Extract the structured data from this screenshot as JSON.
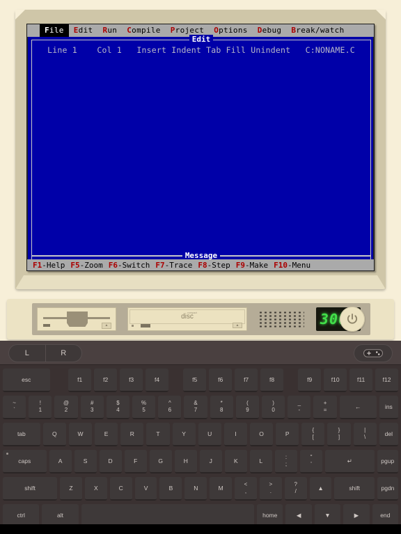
{
  "dos": {
    "menubar": [
      {
        "pre": "",
        "hot": "F",
        "post": "ile",
        "selected": true
      },
      {
        "pre": "",
        "hot": "E",
        "post": "dit",
        "selected": false
      },
      {
        "pre": "",
        "hot": "R",
        "post": "un",
        "selected": false
      },
      {
        "pre": "",
        "hot": "C",
        "post": "ompile",
        "selected": false
      },
      {
        "pre": "",
        "hot": "P",
        "post": "roject",
        "selected": false
      },
      {
        "pre": "",
        "hot": "O",
        "post": "ptions",
        "selected": false
      },
      {
        "pre": "",
        "hot": "D",
        "post": "ebug",
        "selected": false
      },
      {
        "pre": "",
        "hot": "B",
        "post": "reak/watch",
        "selected": false
      }
    ],
    "edit_window": {
      "title": "Edit",
      "status_line": "Line 1    Col 1   Insert Indent Tab Fill Unindent   C:NONAME.C",
      "line": "Line 1",
      "col": "Col 1",
      "insert_mode": "Insert",
      "indent": "Indent",
      "tab": "Tab",
      "fill": "Fill",
      "unindent": "Unindent",
      "filename": "C:NONAME.C",
      "body_text": ""
    },
    "message_window": {
      "title": "Message",
      "body_text": ""
    },
    "fkeys": [
      {
        "hot": "F1",
        "label": "-Help"
      },
      {
        "hot": "F5",
        "label": "-Zoom"
      },
      {
        "hot": "F6",
        "label": "-Switch"
      },
      {
        "hot": "F7",
        "label": "-Trace"
      },
      {
        "hot": "F8",
        "label": "-Step"
      },
      {
        "hot": "F9",
        "label": "-Make"
      },
      {
        "hot": "F10",
        "label": "-Menu"
      }
    ],
    "colors": {
      "screen_blue": "#0000a8",
      "menubar_gray": "#aaaaaa",
      "hotkey_red": "#aa0000",
      "status_text": "#b8b8c8"
    }
  },
  "pc_case": {
    "floppy_drive": {
      "name": "floppy-drive",
      "eject_label": "▲"
    },
    "cd_drive": {
      "logo_main": "disc",
      "logo_small": "compact",
      "eject_label": "▲"
    },
    "speaker": {
      "name": "speaker-grille"
    },
    "led_display": {
      "value": "3000",
      "color": "#42e04a"
    },
    "power_button": {
      "label": "power"
    }
  },
  "keyboard": {
    "toolbar": {
      "mouse_left": "L",
      "mouse_right": "R",
      "gamepad": "gamepad-icon"
    },
    "rows": [
      {
        "name": "function-row",
        "keys": [
          {
            "label": "esc",
            "flex": 2.05
          },
          {
            "spacer": true,
            "flex": 0.85
          },
          {
            "label": "f1",
            "flex": 1
          },
          {
            "label": "f2",
            "flex": 1
          },
          {
            "label": "f3",
            "flex": 1
          },
          {
            "label": "f4",
            "flex": 1
          },
          {
            "spacer": true,
            "flex": 0.6
          },
          {
            "label": "f5",
            "flex": 1
          },
          {
            "label": "f6",
            "flex": 1
          },
          {
            "label": "f7",
            "flex": 1
          },
          {
            "label": "f8",
            "flex": 1
          },
          {
            "spacer": true,
            "flex": 0.6
          },
          {
            "label": "f9",
            "flex": 1
          },
          {
            "label": "f10",
            "flex": 1
          },
          {
            "label": "f11",
            "flex": 1
          },
          {
            "label": "f12",
            "flex": 1
          }
        ]
      },
      {
        "name": "number-row",
        "keys": [
          {
            "top": "~",
            "bot": "`",
            "flex": 1
          },
          {
            "top": "!",
            "bot": "1",
            "flex": 1
          },
          {
            "top": "@",
            "bot": "2",
            "flex": 1
          },
          {
            "top": "#",
            "bot": "3",
            "flex": 1
          },
          {
            "top": "$",
            "bot": "4",
            "flex": 1
          },
          {
            "top": "%",
            "bot": "5",
            "flex": 1
          },
          {
            "top": "^",
            "bot": "6",
            "flex": 1
          },
          {
            "top": "&",
            "bot": "7",
            "flex": 1
          },
          {
            "top": "*",
            "bot": "8",
            "flex": 1
          },
          {
            "top": "(",
            "bot": "9",
            "flex": 1
          },
          {
            "top": ")",
            "bot": "0",
            "flex": 1
          },
          {
            "top": "_",
            "bot": "-",
            "flex": 1
          },
          {
            "top": "+",
            "bot": "=",
            "flex": 1
          },
          {
            "label": "←",
            "flex": 1.6
          },
          {
            "label": "ins",
            "flex": 0.82
          }
        ]
      },
      {
        "name": "qwerty-row",
        "keys": [
          {
            "label": "tab",
            "flex": 1.62
          },
          {
            "label": "Q",
            "flex": 1
          },
          {
            "label": "W",
            "flex": 1
          },
          {
            "label": "E",
            "flex": 1
          },
          {
            "label": "R",
            "flex": 1
          },
          {
            "label": "T",
            "flex": 1
          },
          {
            "label": "Y",
            "flex": 1
          },
          {
            "label": "U",
            "flex": 1
          },
          {
            "label": "I",
            "flex": 1
          },
          {
            "label": "O",
            "flex": 1
          },
          {
            "label": "P",
            "flex": 1
          },
          {
            "top": "{",
            "bot": "[",
            "flex": 1
          },
          {
            "top": "}",
            "bot": "]",
            "flex": 1
          },
          {
            "top": "|",
            "bot": "\\",
            "flex": 1
          },
          {
            "label": "del",
            "flex": 0.82
          }
        ]
      },
      {
        "name": "home-row",
        "keys": [
          {
            "label": "caps",
            "flex": 1.95,
            "dot": true
          },
          {
            "label": "A",
            "flex": 1
          },
          {
            "label": "S",
            "flex": 1
          },
          {
            "label": "D",
            "flex": 1
          },
          {
            "label": "F",
            "flex": 1
          },
          {
            "label": "G",
            "flex": 1
          },
          {
            "label": "H",
            "flex": 1
          },
          {
            "label": "J",
            "flex": 1
          },
          {
            "label": "K",
            "flex": 1
          },
          {
            "label": "L",
            "flex": 1
          },
          {
            "top": ":",
            "bot": ";",
            "flex": 1
          },
          {
            "top": "\"",
            "bot": "'",
            "flex": 1
          },
          {
            "label": "↵",
            "flex": 2.2
          },
          {
            "label": "pgup",
            "flex": 0.95
          }
        ]
      },
      {
        "name": "shift-row",
        "keys": [
          {
            "label": "shift",
            "flex": 2.45
          },
          {
            "label": "Z",
            "flex": 1
          },
          {
            "label": "X",
            "flex": 1
          },
          {
            "label": "C",
            "flex": 1
          },
          {
            "label": "V",
            "flex": 1
          },
          {
            "label": "B",
            "flex": 1
          },
          {
            "label": "N",
            "flex": 1
          },
          {
            "label": "M",
            "flex": 1
          },
          {
            "top": "<",
            "bot": ",",
            "flex": 1
          },
          {
            "top": ">",
            "bot": ".",
            "flex": 1
          },
          {
            "top": "?",
            "bot": "/",
            "flex": 1
          },
          {
            "label": "▲",
            "flex": 1
          },
          {
            "label": "shift",
            "flex": 1.8
          },
          {
            "label": "pgdn",
            "flex": 0.95
          }
        ]
      },
      {
        "name": "bottom-row",
        "keys": [
          {
            "label": "ctrl",
            "flex": 1.75
          },
          {
            "label": "alt",
            "flex": 1.75
          },
          {
            "label": "",
            "flex": 8.3,
            "name": "space-key"
          },
          {
            "label": "home",
            "flex": 1.25
          },
          {
            "label": "◀",
            "flex": 1.25
          },
          {
            "label": "▼",
            "flex": 1.25
          },
          {
            "label": "▶",
            "flex": 1.25
          },
          {
            "label": "end",
            "flex": 1.25
          }
        ]
      }
    ]
  }
}
